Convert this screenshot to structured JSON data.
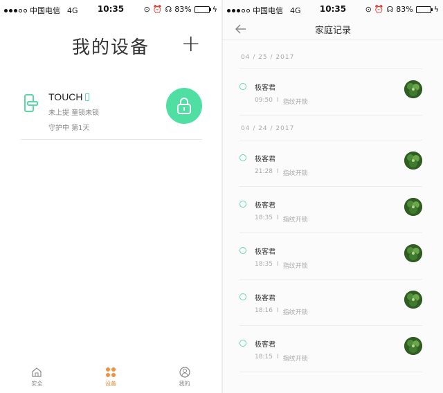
{
  "status_bar": {
    "carrier": "中国电信",
    "network": "4G",
    "time": "10:35",
    "battery": "83%",
    "battery_level": 0.83
  },
  "home": {
    "title": "我的设备",
    "add_symbol": "+",
    "device": {
      "name": "TOUCH",
      "status": "未上提 童锁未锁",
      "guard": "守护中 第1天",
      "accent": "#4fdfa3"
    },
    "tabs": [
      {
        "label": "安全",
        "icon": "home-icon"
      },
      {
        "label": "设备",
        "icon": "grid-icon",
        "active": true,
        "color": "#f0923d"
      },
      {
        "label": "我的",
        "icon": "profile-icon"
      }
    ]
  },
  "records_page": {
    "title": "家庭记录",
    "groups": [
      {
        "date": "04 / 25 / 2017",
        "records": [
          {
            "name": "极客君",
            "time": "09:50",
            "sep": "I",
            "type": "指纹开锁"
          }
        ]
      },
      {
        "date": "04 / 24 / 2017",
        "records": [
          {
            "name": "极客君",
            "time": "21:28",
            "sep": "I",
            "type": "指纹开锁"
          },
          {
            "name": "极客君",
            "time": "18:35",
            "sep": "I",
            "type": "指纹开锁"
          },
          {
            "name": "极客君",
            "time": "18:35",
            "sep": "I",
            "type": "指纹开锁"
          },
          {
            "name": "极客君",
            "time": "18:16",
            "sep": "I",
            "type": "指纹开锁"
          },
          {
            "name": "极客君",
            "time": "18:15",
            "sep": "I",
            "type": "指纹开锁"
          }
        ]
      }
    ]
  }
}
